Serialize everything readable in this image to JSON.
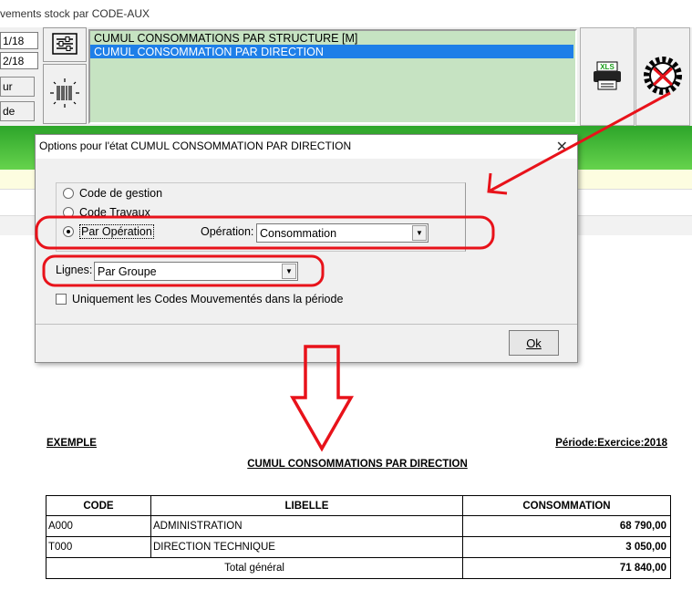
{
  "window": {
    "title": "vements stock par CODE-AUX"
  },
  "side": {
    "date_from": "1/18",
    "date_to": "2/18",
    "btn1_label": "ur",
    "btn2_label": "de"
  },
  "report_list": {
    "items": [
      {
        "label": "CUMUL CONSOMMATIONS PAR STRUCTURE   [M]"
      },
      {
        "label": "CUMUL CONSOMMATION PAR DIRECTION"
      }
    ]
  },
  "icons": {
    "settings": "sliders-icon",
    "barcode": "barcode-scanner-icon",
    "xls": "xls-printer-icon",
    "tools": "tools-disabled-icon"
  },
  "dialog": {
    "title": "Options pour l'état CUMUL CONSOMMATION PAR DIRECTION",
    "radios": [
      {
        "label": "Code de gestion",
        "checked": false
      },
      {
        "label": "Code Travaux",
        "checked": false
      },
      {
        "label": "Par Opération",
        "checked": true
      }
    ],
    "operation_label": "Opération:",
    "operation_value": "Consommation",
    "lignes_label": "Lignes:",
    "lignes_value": "Par Groupe",
    "checkbox_label": "Uniquement les Codes Mouvementés dans la période",
    "ok_label": "Ok"
  },
  "report": {
    "example_label": "EXEMPLE",
    "period_label": "Période:Exercice:2018",
    "title": "CUMUL CONSOMMATIONS PAR DIRECTION",
    "headers": [
      "CODE",
      "LIBELLE",
      "CONSOMMATION"
    ],
    "rows": [
      {
        "code": "A000",
        "libelle": "ADMINISTRATION",
        "value": "68  790,00"
      },
      {
        "code": "T000",
        "libelle": "DIRECTION TECHNIQUE",
        "value": "3  050,00"
      }
    ],
    "total_label": "Total général",
    "total_value": "71  840,00"
  },
  "colors": {
    "list_bg": "#c6e3c2",
    "selection": "#1e7fe8",
    "annotation": "#e8121a",
    "band_green": "#2da52a"
  }
}
